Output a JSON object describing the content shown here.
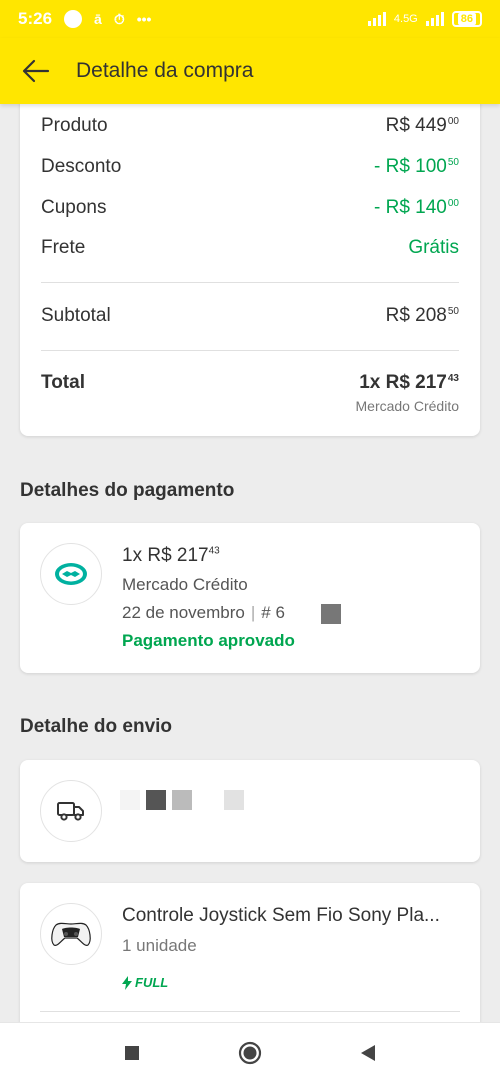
{
  "status_bar": {
    "time": "5:26",
    "network": "4.5G",
    "battery": "86"
  },
  "header": {
    "title": "Detalhe da compra"
  },
  "summary": {
    "produto_label": "Produto",
    "produto_value": "R$ 449",
    "produto_cents": "00",
    "desconto_label": "Desconto",
    "desconto_value": "- R$ 100",
    "desconto_cents": "50",
    "cupons_label": "Cupons",
    "cupons_value": "- R$ 140",
    "cupons_cents": "00",
    "frete_label": "Frete",
    "frete_value": "Grátis",
    "subtotal_label": "Subtotal",
    "subtotal_value": "R$ 208",
    "subtotal_cents": "50",
    "total_label": "Total",
    "total_value": "1x R$ 217",
    "total_cents": "43",
    "total_method": "Mercado Crédito"
  },
  "payment": {
    "section_title": "Detalhes do pagamento",
    "amount": "1x R$ 217",
    "amount_cents": "43",
    "method": "Mercado Crédito",
    "date": "22 de novembro",
    "separator": "|",
    "operation": "# 6",
    "status": "Pagamento aprovado"
  },
  "shipping": {
    "section_title": "Detalhe do envio"
  },
  "product": {
    "title": "Controle Joystick Sem Fio Sony Pla...",
    "quantity": "1 unidade",
    "badge": "FULL"
  },
  "colors": {
    "brand_yellow": "#ffe600",
    "success_green": "#00a650",
    "mercado_teal": "#00b1a0"
  },
  "icons": {
    "back": "arrow-left-icon",
    "payment": "mercado-credito-handshake-icon",
    "shipping": "truck-icon",
    "product": "ps5-controller-icon",
    "badge": "lightning-icon"
  }
}
